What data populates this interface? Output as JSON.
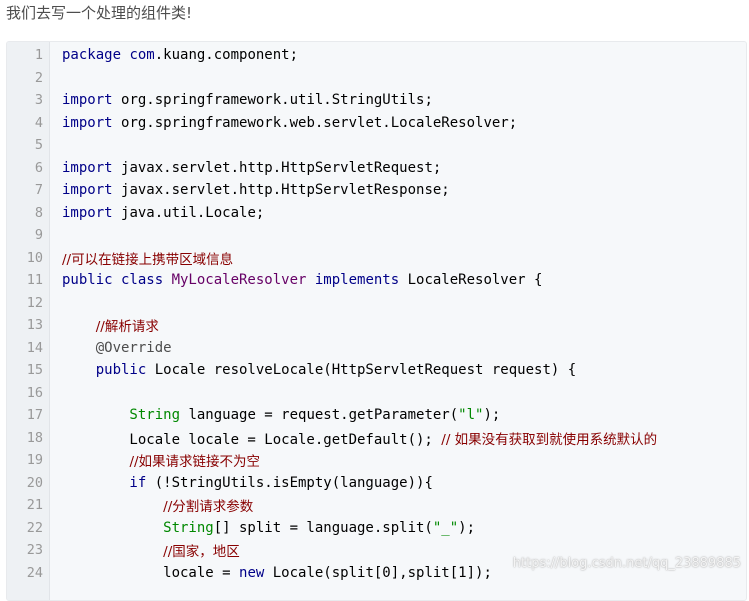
{
  "intro_text": "我们去写一个处理的组件类!",
  "colors": {
    "keyword": "#000088",
    "class_name": "#660066",
    "string": "#008800",
    "comment": "#880000",
    "plain": "#000000",
    "line_number": "#999999",
    "background": "#f6f8fa"
  },
  "code_lines": [
    {
      "n": "1",
      "tokens": [
        {
          "t": "kw",
          "v": "package "
        },
        {
          "t": "kw",
          "v": "com"
        },
        {
          "t": "pl",
          "v": ".kuang.component;"
        }
      ]
    },
    {
      "n": "2",
      "tokens": []
    },
    {
      "n": "3",
      "tokens": [
        {
          "t": "kw",
          "v": "import "
        },
        {
          "t": "pl",
          "v": "org.springframework.util.StringUtils;"
        }
      ]
    },
    {
      "n": "4",
      "tokens": [
        {
          "t": "kw",
          "v": "import "
        },
        {
          "t": "pl",
          "v": "org.springframework.web.servlet.LocaleResolver;"
        }
      ]
    },
    {
      "n": "5",
      "tokens": []
    },
    {
      "n": "6",
      "tokens": [
        {
          "t": "kw",
          "v": "import "
        },
        {
          "t": "pl",
          "v": "javax.servlet.http.HttpServletRequest;"
        }
      ]
    },
    {
      "n": "7",
      "tokens": [
        {
          "t": "kw",
          "v": "import "
        },
        {
          "t": "pl",
          "v": "javax.servlet.http.HttpServletResponse;"
        }
      ]
    },
    {
      "n": "8",
      "tokens": [
        {
          "t": "kw",
          "v": "import "
        },
        {
          "t": "pl",
          "v": "java.util.Locale;"
        }
      ]
    },
    {
      "n": "9",
      "tokens": []
    },
    {
      "n": "10",
      "tokens": [
        {
          "t": "cmt",
          "v": "//可以在链接上携带区域信息"
        }
      ]
    },
    {
      "n": "11",
      "tokens": [
        {
          "t": "kw",
          "v": "public class "
        },
        {
          "t": "cls",
          "v": "MyLocaleResolver "
        },
        {
          "t": "kw",
          "v": "implements "
        },
        {
          "t": "pl",
          "v": "LocaleResolver {"
        }
      ]
    },
    {
      "n": "12",
      "tokens": []
    },
    {
      "n": "13",
      "tokens": [
        {
          "t": "pl",
          "v": "    "
        },
        {
          "t": "cmt",
          "v": "//解析请求"
        }
      ]
    },
    {
      "n": "14",
      "tokens": [
        {
          "t": "ann",
          "v": "    @Override"
        }
      ]
    },
    {
      "n": "15",
      "tokens": [
        {
          "t": "kw",
          "v": "    public "
        },
        {
          "t": "pl",
          "v": "Locale resolveLocale(HttpServletRequest request) {"
        }
      ]
    },
    {
      "n": "16",
      "tokens": []
    },
    {
      "n": "17",
      "tokens": [
        {
          "t": "typ",
          "v": "        String "
        },
        {
          "t": "pl",
          "v": "language = request.getParameter("
        },
        {
          "t": "str",
          "v": "\"l\""
        },
        {
          "t": "pl",
          "v": ");"
        }
      ]
    },
    {
      "n": "18",
      "tokens": [
        {
          "t": "pl",
          "v": "        Locale locale = Locale.getDefault(); "
        },
        {
          "t": "cmt",
          "v": "// 如果没有获取到就使用系统默认的"
        }
      ]
    },
    {
      "n": "19",
      "tokens": [
        {
          "t": "pl",
          "v": "        "
        },
        {
          "t": "cmt",
          "v": "//如果请求链接不为空"
        }
      ]
    },
    {
      "n": "20",
      "tokens": [
        {
          "t": "kw",
          "v": "        if "
        },
        {
          "t": "pl",
          "v": "(!StringUtils.isEmpty(language)){"
        }
      ]
    },
    {
      "n": "21",
      "tokens": [
        {
          "t": "pl",
          "v": "            "
        },
        {
          "t": "cmt",
          "v": "//分割请求参数"
        }
      ]
    },
    {
      "n": "22",
      "tokens": [
        {
          "t": "typ",
          "v": "            String"
        },
        {
          "t": "pl",
          "v": "[] split = language.split("
        },
        {
          "t": "str",
          "v": "\"_\""
        },
        {
          "t": "pl",
          "v": ");"
        }
      ]
    },
    {
      "n": "23",
      "tokens": [
        {
          "t": "pl",
          "v": "            "
        },
        {
          "t": "cmt",
          "v": "//国家，地区"
        }
      ]
    },
    {
      "n": "24",
      "tokens": [
        {
          "t": "pl",
          "v": "            locale = "
        },
        {
          "t": "kw",
          "v": "new "
        },
        {
          "t": "pl",
          "v": "Locale(split[0],split[1]);"
        }
      ]
    }
  ],
  "watermark": "https://blog.csdn.net/qq_23889885"
}
